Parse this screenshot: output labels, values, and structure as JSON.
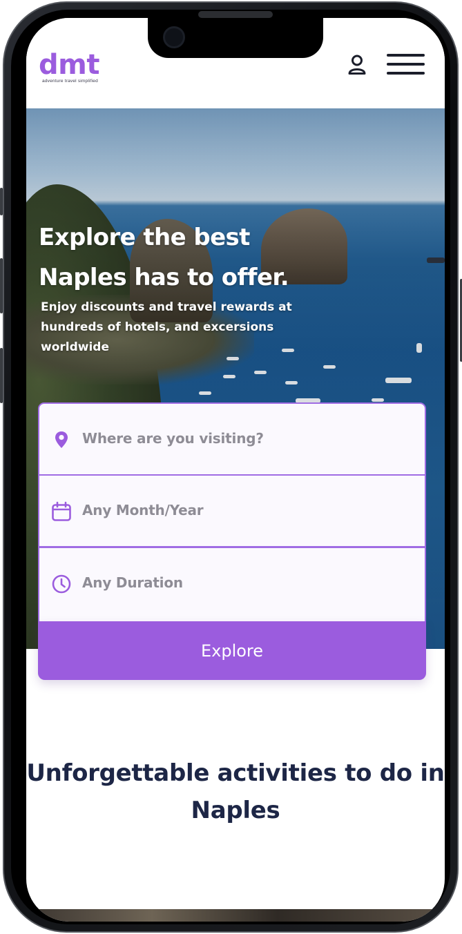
{
  "header": {
    "logo_text": "dmt",
    "logo_tagline": "adventure travel simplified",
    "account_icon": "user-icon",
    "menu_icon": "hamburger-menu-icon"
  },
  "hero": {
    "title_line1": "Explore the best",
    "title_line2": "Naples has to offer.",
    "subtitle": "Enjoy discounts and travel rewards at hundreds of hotels, and excersions worldwide"
  },
  "search": {
    "destination_placeholder": "Where are you visiting?",
    "destination_icon": "map-pin-icon",
    "date_placeholder": "Any Month/Year",
    "date_icon": "calendar-icon",
    "duration_placeholder": "Any Duration",
    "duration_icon": "clock-icon",
    "explore_label": "Explore"
  },
  "activities": {
    "title": "Unforgettable activities to do in Naples"
  },
  "colors": {
    "brand_purple": "#9b5cde",
    "heading_navy": "#1d2646",
    "placeholder_gray": "#8e8c95"
  }
}
